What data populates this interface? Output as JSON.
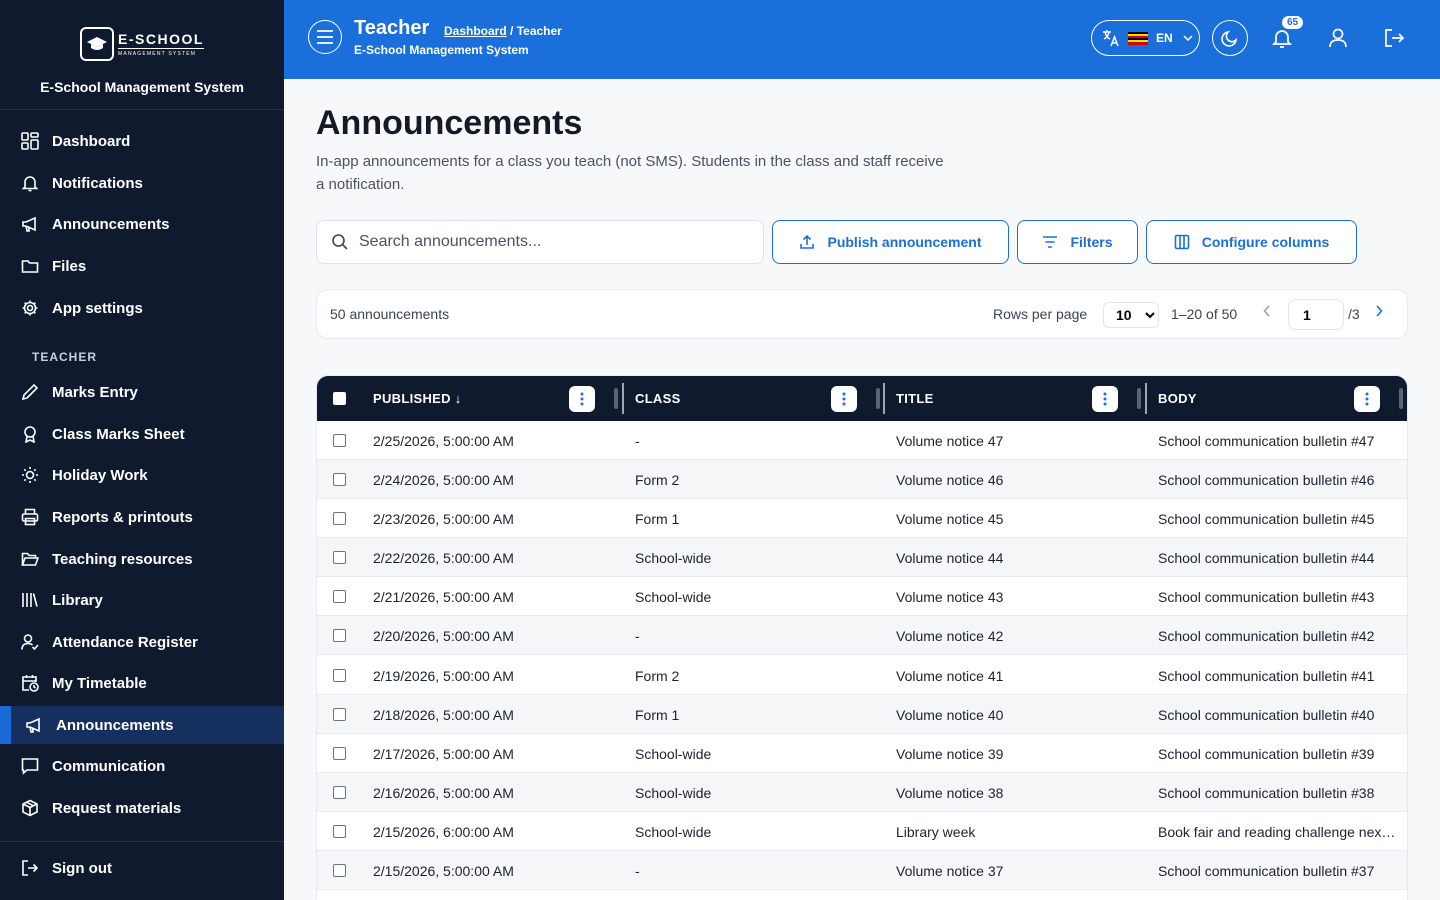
{
  "sidebar": {
    "logo_text": "E-SCHOOL",
    "logo_subtext": "MANAGEMENT SYSTEM",
    "system_name": "E-School Management System",
    "items": [
      {
        "label": "Dashboard",
        "icon": "dashboard-icon"
      },
      {
        "label": "Notifications",
        "icon": "bell-icon"
      },
      {
        "label": "Announcements",
        "icon": "megaphone-icon"
      },
      {
        "label": "Files",
        "icon": "folder-icon"
      },
      {
        "label": "App settings",
        "icon": "gear-icon"
      }
    ],
    "section_label": "TEACHER",
    "teacher_items": [
      {
        "label": "Marks Entry",
        "icon": "pencil-icon"
      },
      {
        "label": "Class Marks Sheet",
        "icon": "award-icon"
      },
      {
        "label": "Holiday Work",
        "icon": "sun-icon"
      },
      {
        "label": "Reports & printouts",
        "icon": "printer-icon"
      },
      {
        "label": "Teaching resources",
        "icon": "folder-open-icon"
      },
      {
        "label": "Library",
        "icon": "library-icon"
      },
      {
        "label": "Attendance Register",
        "icon": "user-check-icon"
      },
      {
        "label": "My Timetable",
        "icon": "calendar-clock-icon"
      },
      {
        "label": "Announcements",
        "icon": "megaphone-icon",
        "active": true
      },
      {
        "label": "Communication",
        "icon": "message-icon"
      },
      {
        "label": "Request materials",
        "icon": "package-icon"
      }
    ],
    "sign_out": "Sign out"
  },
  "header": {
    "title": "Teacher",
    "breadcrumb_link": "Dashboard",
    "breadcrumb_sep": " / ",
    "breadcrumb_current": "Teacher",
    "subtitle": "E-School Management System",
    "language": "EN",
    "notification_count": "65"
  },
  "main": {
    "title": "Announcements",
    "description": "In-app announcements for a class you teach (not SMS). Students in the class and staff receive a notification.",
    "search_placeholder": "Search announcements...",
    "publish_label": "Publish announcement",
    "filters_label": "Filters",
    "configure_label": "Configure columns"
  },
  "pager": {
    "count": "50 announcements",
    "rows_per_page_label": "Rows per page",
    "rows_per_page": "10",
    "range": "1–20 of 50",
    "page": "1",
    "total_pages": "/3"
  },
  "table": {
    "columns": [
      "PUBLISHED",
      "CLASS",
      "TITLE",
      "BODY"
    ],
    "sort_indicator": "↓",
    "rows": [
      [
        "2/25/2026, 5:00:00 AM",
        "-",
        "Volume notice 47",
        "School communication bulletin #47"
      ],
      [
        "2/24/2026, 5:00:00 AM",
        "Form 2",
        "Volume notice 46",
        "School communication bulletin #46"
      ],
      [
        "2/23/2026, 5:00:00 AM",
        "Form 1",
        "Volume notice 45",
        "School communication bulletin #45"
      ],
      [
        "2/22/2026, 5:00:00 AM",
        "School-wide",
        "Volume notice 44",
        "School communication bulletin #44"
      ],
      [
        "2/21/2026, 5:00:00 AM",
        "School-wide",
        "Volume notice 43",
        "School communication bulletin #43"
      ],
      [
        "2/20/2026, 5:00:00 AM",
        "-",
        "Volume notice 42",
        "School communication bulletin #42"
      ],
      [
        "2/19/2026, 5:00:00 AM",
        "Form 2",
        "Volume notice 41",
        "School communication bulletin #41"
      ],
      [
        "2/18/2026, 5:00:00 AM",
        "Form 1",
        "Volume notice 40",
        "School communication bulletin #40"
      ],
      [
        "2/17/2026, 5:00:00 AM",
        "School-wide",
        "Volume notice 39",
        "School communication bulletin #39"
      ],
      [
        "2/16/2026, 5:00:00 AM",
        "School-wide",
        "Volume notice 38",
        "School communication bulletin #38"
      ],
      [
        "2/15/2026, 6:00:00 AM",
        "School-wide",
        "Library week",
        "Book fair and reading challenge next week"
      ],
      [
        "2/15/2026, 5:00:00 AM",
        "-",
        "Volume notice 37",
        "School communication bulletin #37"
      ]
    ]
  },
  "colors": {
    "sidebar_bg": "#0f1a2e",
    "header_bg": "#1a6fdb",
    "accent": "#1a6fdb",
    "active_item_bg": "#15305e"
  }
}
